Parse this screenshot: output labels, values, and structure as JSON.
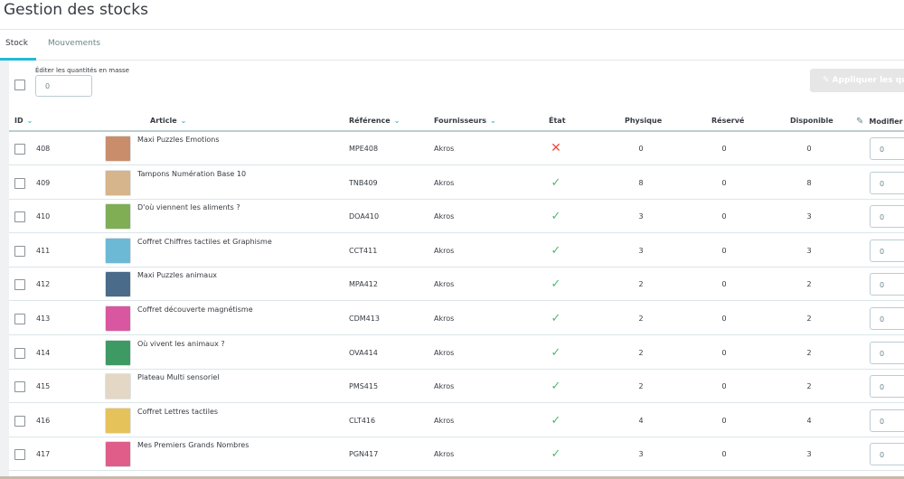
{
  "page": {
    "title": "Gestion des stocks"
  },
  "tabs": [
    {
      "label": "Stock"
    },
    {
      "label": "Mouvements"
    }
  ],
  "bulk": {
    "label": "Éditer les quantités en masse",
    "value": "0",
    "apply_label": "Appliquer les quantités"
  },
  "columns": {
    "id": "ID",
    "article": "Article",
    "reference": "Référence",
    "fournisseurs": "Fournisseurs",
    "etat": "État",
    "physique": "Physique",
    "reserve": "Réservé",
    "disponible": "Disponible",
    "modifier": "Modifier"
  },
  "rows": [
    {
      "id": "408",
      "article": "Maxi Puzzles Emotions",
      "reference": "MPE408",
      "fournisseur": "Akros",
      "etat": "✕",
      "physique": "0",
      "reserve": "0",
      "disponible": "0",
      "modifier": "0",
      "thumb_color": "#c98d6b"
    },
    {
      "id": "409",
      "article": "Tampons Numération Base 10",
      "reference": "TNB409",
      "fournisseur": "Akros",
      "etat": "✓",
      "physique": "8",
      "reserve": "0",
      "disponible": "8",
      "modifier": "0",
      "thumb_color": "#d6b48c"
    },
    {
      "id": "410",
      "article": "D'où viennent les aliments ?",
      "reference": "DOA410",
      "fournisseur": "Akros",
      "etat": "✓",
      "physique": "3",
      "reserve": "0",
      "disponible": "3",
      "modifier": "0",
      "thumb_color": "#7fae55"
    },
    {
      "id": "411",
      "article": "Coffret Chiffres tactiles et Graphisme",
      "reference": "CCT411",
      "fournisseur": "Akros",
      "etat": "✓",
      "physique": "3",
      "reserve": "0",
      "disponible": "3",
      "modifier": "0",
      "thumb_color": "#6cb9d6"
    },
    {
      "id": "412",
      "article": "Maxi Puzzles animaux",
      "reference": "MPA412",
      "fournisseur": "Akros",
      "etat": "✓",
      "physique": "2",
      "reserve": "0",
      "disponible": "2",
      "modifier": "0",
      "thumb_color": "#4a6b8a"
    },
    {
      "id": "413",
      "article": "Coffret découverte magnétisme",
      "reference": "CDM413",
      "fournisseur": "Akros",
      "etat": "✓",
      "physique": "2",
      "reserve": "0",
      "disponible": "2",
      "modifier": "0",
      "thumb_color": "#d957a0"
    },
    {
      "id": "414",
      "article": "Où vivent les animaux ?",
      "reference": "OVA414",
      "fournisseur": "Akros",
      "etat": "✓",
      "physique": "2",
      "reserve": "0",
      "disponible": "2",
      "modifier": "0",
      "thumb_color": "#3d9a63"
    },
    {
      "id": "415",
      "article": "Plateau Multi sensoriel",
      "reference": "PMS415",
      "fournisseur": "Akros",
      "etat": "✓",
      "physique": "2",
      "reserve": "0",
      "disponible": "2",
      "modifier": "0",
      "thumb_color": "#e5d7c5"
    },
    {
      "id": "416",
      "article": "Coffret Lettres tactiles",
      "reference": "CLT416",
      "fournisseur": "Akros",
      "etat": "✓",
      "physique": "4",
      "reserve": "0",
      "disponible": "4",
      "modifier": "0",
      "thumb_color": "#e6c25a"
    },
    {
      "id": "417",
      "article": "Mes Premiers Grands Nombres",
      "reference": "PGN417",
      "fournisseur": "Akros",
      "etat": "✓",
      "physique": "3",
      "reserve": "0",
      "disponible": "3",
      "modifier": "0",
      "thumb_color": "#e05d8a"
    }
  ],
  "colors": {
    "accent": "#25b9d7",
    "ok": "#4cbb6c",
    "error": "#f54c3e"
  }
}
